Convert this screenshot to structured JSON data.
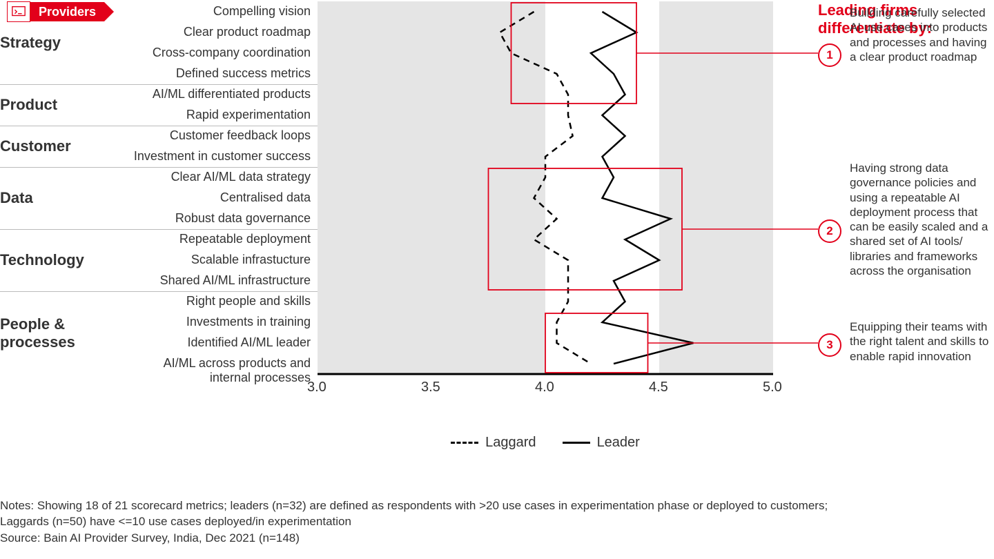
{
  "badge": {
    "label": "Providers"
  },
  "categories": [
    {
      "name": "Strategy",
      "metrics": [
        "Compelling vision",
        "Clear product roadmap",
        "Cross-company coordination",
        "Defined success metrics"
      ]
    },
    {
      "name": "Product",
      "metrics": [
        "AI/ML differentiated products",
        "Rapid experimentation"
      ]
    },
    {
      "name": "Customer",
      "metrics": [
        "Customer feedback loops",
        "Investment in customer success"
      ]
    },
    {
      "name": "Data",
      "metrics": [
        "Clear AI/ML data strategy",
        "Centralised data",
        "Robust data governance"
      ]
    },
    {
      "name": "Technology",
      "metrics": [
        "Repeatable deployment",
        "Scalable infrastucture",
        "Shared AI/ML infrastructure"
      ]
    },
    {
      "name": "People & processes",
      "metrics": [
        "Right people and skills",
        "Investments in training",
        "Identified AI/ML leader",
        "AI/ML across products and internal processes"
      ]
    }
  ],
  "right": {
    "title": "Leading firms differentiate by:",
    "items": [
      {
        "num": "1",
        "text": "Building carefully selected AI use cases into products and processes and having a clear product roadmap"
      },
      {
        "num": "2",
        "text": "Having strong data governance policies and using a repeatable AI deployment process that can be easily scaled and a shared set of AI tools/ libraries and frameworks across the organisation"
      },
      {
        "num": "3",
        "text": "Equipping their teams with the right talent and skills to enable rapid innovation"
      }
    ]
  },
  "legend": {
    "laggard": "Laggard",
    "leader": "Leader"
  },
  "xaxis": {
    "ticks": [
      "3.0",
      "3.5",
      "4.0",
      "4.5",
      "5.0"
    ]
  },
  "notes": {
    "line1": "Notes: Showing 18 of 21 scorecard metrics; leaders (n=32) are defined as respondents with >20 use cases in experimentation phase or deployed to customers;",
    "line2": "Laggards (n=50) have <=10 use cases deployed/in experimentation",
    "line3": "Source: Bain AI Provider Survey, India, Dec 2021 (n=148)"
  },
  "chart_data": {
    "type": "line",
    "xlabel": "",
    "ylabel": "",
    "xlim": [
      3.0,
      5.0
    ],
    "metrics": [
      "Compelling vision",
      "Clear product roadmap",
      "Cross-company coordination",
      "Defined success metrics",
      "AI/ML differentiated products",
      "Rapid experimentation",
      "Customer feedback loops",
      "Investment in customer success",
      "Clear AI/ML data strategy",
      "Centralised data",
      "Robust data governance",
      "Repeatable deployment",
      "Scalable infrastucture",
      "Shared AI/ML infrastructure",
      "Right people and skills",
      "Investments in training",
      "Identified AI/ML leader",
      "AI/ML across products and internal processes"
    ],
    "series": [
      {
        "name": "Laggard",
        "style": "dashed",
        "values": [
          3.95,
          3.8,
          3.85,
          4.05,
          4.1,
          4.1,
          4.12,
          4.0,
          4.0,
          3.95,
          4.05,
          3.95,
          4.1,
          4.1,
          4.1,
          4.05,
          4.05,
          4.2
        ]
      },
      {
        "name": "Leader",
        "style": "solid",
        "values": [
          4.25,
          4.4,
          4.2,
          4.3,
          4.35,
          4.25,
          4.35,
          4.25,
          4.3,
          4.25,
          4.55,
          4.35,
          4.5,
          4.3,
          4.35,
          4.25,
          4.65,
          4.3
        ]
      }
    ],
    "highlight_boxes": [
      {
        "label": "1",
        "metric_start": 0,
        "metric_end": 4,
        "x_start": 3.85,
        "x_end": 4.4
      },
      {
        "label": "2",
        "metric_start": 8,
        "metric_end": 13,
        "x_start": 3.75,
        "x_end": 4.6
      },
      {
        "label": "3",
        "metric_start": 15,
        "metric_end": 17,
        "x_start": 4.0,
        "x_end": 4.45
      }
    ]
  }
}
